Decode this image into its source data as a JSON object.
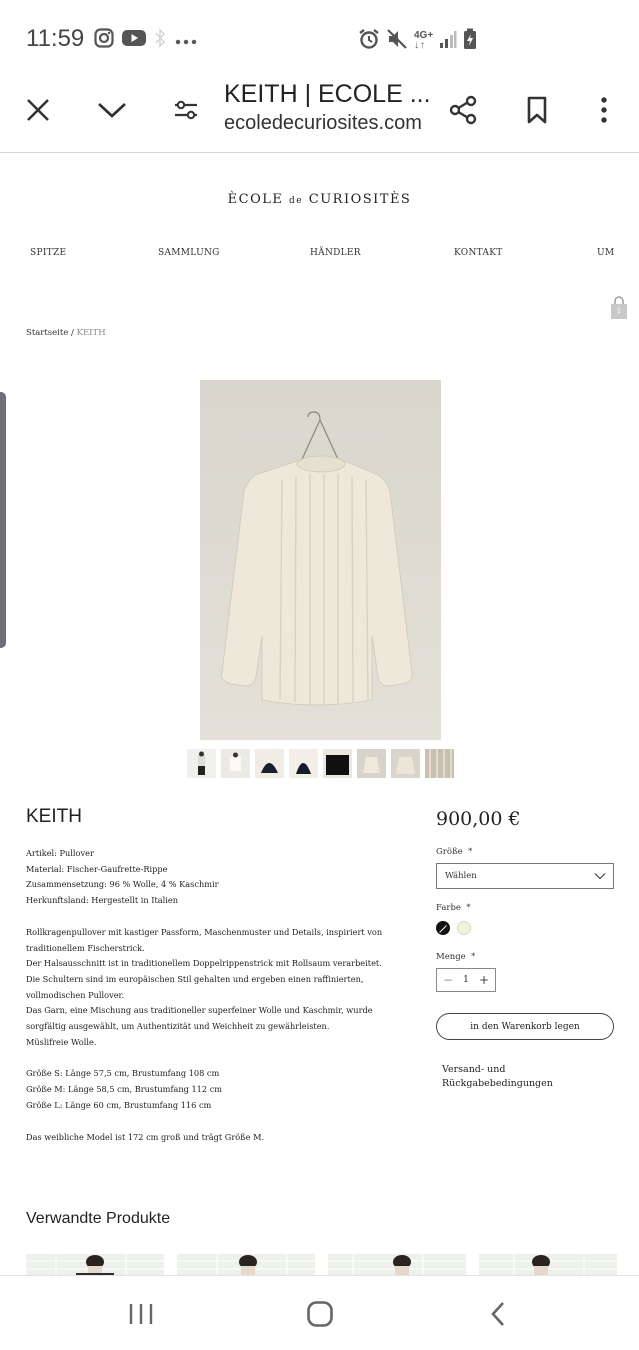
{
  "status_bar": {
    "time": "11:59",
    "icons_left": [
      "instagram-icon",
      "youtube-icon",
      "bluetooth-icon",
      "more-dots-icon"
    ],
    "icons_right": [
      "alarm-icon",
      "mute-icon",
      "4g-icon",
      "signal-icon",
      "battery-charging-icon"
    ],
    "network_label": "4G+"
  },
  "browser": {
    "tab_title": "KEITH | ECOLE ...",
    "domain": "ecoledecuriosites.com"
  },
  "site": {
    "brand_part1": "ÈCOLE",
    "brand_part2": "de",
    "brand_part3": "CURIOSITÈS",
    "nav": [
      "SPITZE",
      "SAMMLUNG",
      "HÄNDLER",
      "KONTAKT",
      "UM"
    ],
    "cart_count": "1"
  },
  "breadcrumb": {
    "home": "Startseite",
    "separator": " / ",
    "current": "KEITH"
  },
  "product": {
    "name": "KEITH",
    "price": "900,00 €",
    "thumbnail_count": 8,
    "description": [
      "Artikel: Pullover",
      "Material: Fischer-Gaufrette-Rippe",
      "Zusammensetzung: 96 % Wolle, 4 % Kaschmir",
      "Herkunftsland: Hergestellt in Italien",
      "",
      "Rollkragenpullover mit kastiger Passform, Maschenmuster und Details, inspiriert von traditionellem Fischerstrick.",
      "Der Halsausschnitt ist in traditionellem Doppelrippenstrick mit Rollsaum verarbeitet. Die Schultern sind im europäischen Stil gehalten und ergeben einen raffinierten, vollmodischen Pullover.",
      "Das Garn, eine Mischung aus traditioneller superfeiner Wolle und Kaschmir, wurde sorgfältig ausgewählt, um Authentizität und Weichheit zu gewährleisten.",
      "Müslifreie Wolle.",
      "",
      "Größe S: Länge 57,5 cm, Brustumfang 108 cm",
      "Größe M: Länge 58,5 cm, Brustumfang 112 cm",
      "Größe L: Länge 60 cm, Brustumfang 116 cm",
      "",
      "Das weibliche Model ist 172 cm groß und trägt Größe M."
    ],
    "size_label": "Größe",
    "size_placeholder": "Wählen",
    "color_label": "Farbe",
    "colors": [
      "#111111",
      "#f3f2dc"
    ],
    "quantity_label": "Menge",
    "quantity": "1",
    "required_mark": "*",
    "add_to_cart": "in den Warenkorb legen",
    "shipping_link": "Versand- und Rückgabebedingungen"
  },
  "related": {
    "title": "Verwandte Produkte",
    "count": 4
  },
  "system_nav": [
    "recent-apps-icon",
    "home-icon",
    "back-icon"
  ]
}
